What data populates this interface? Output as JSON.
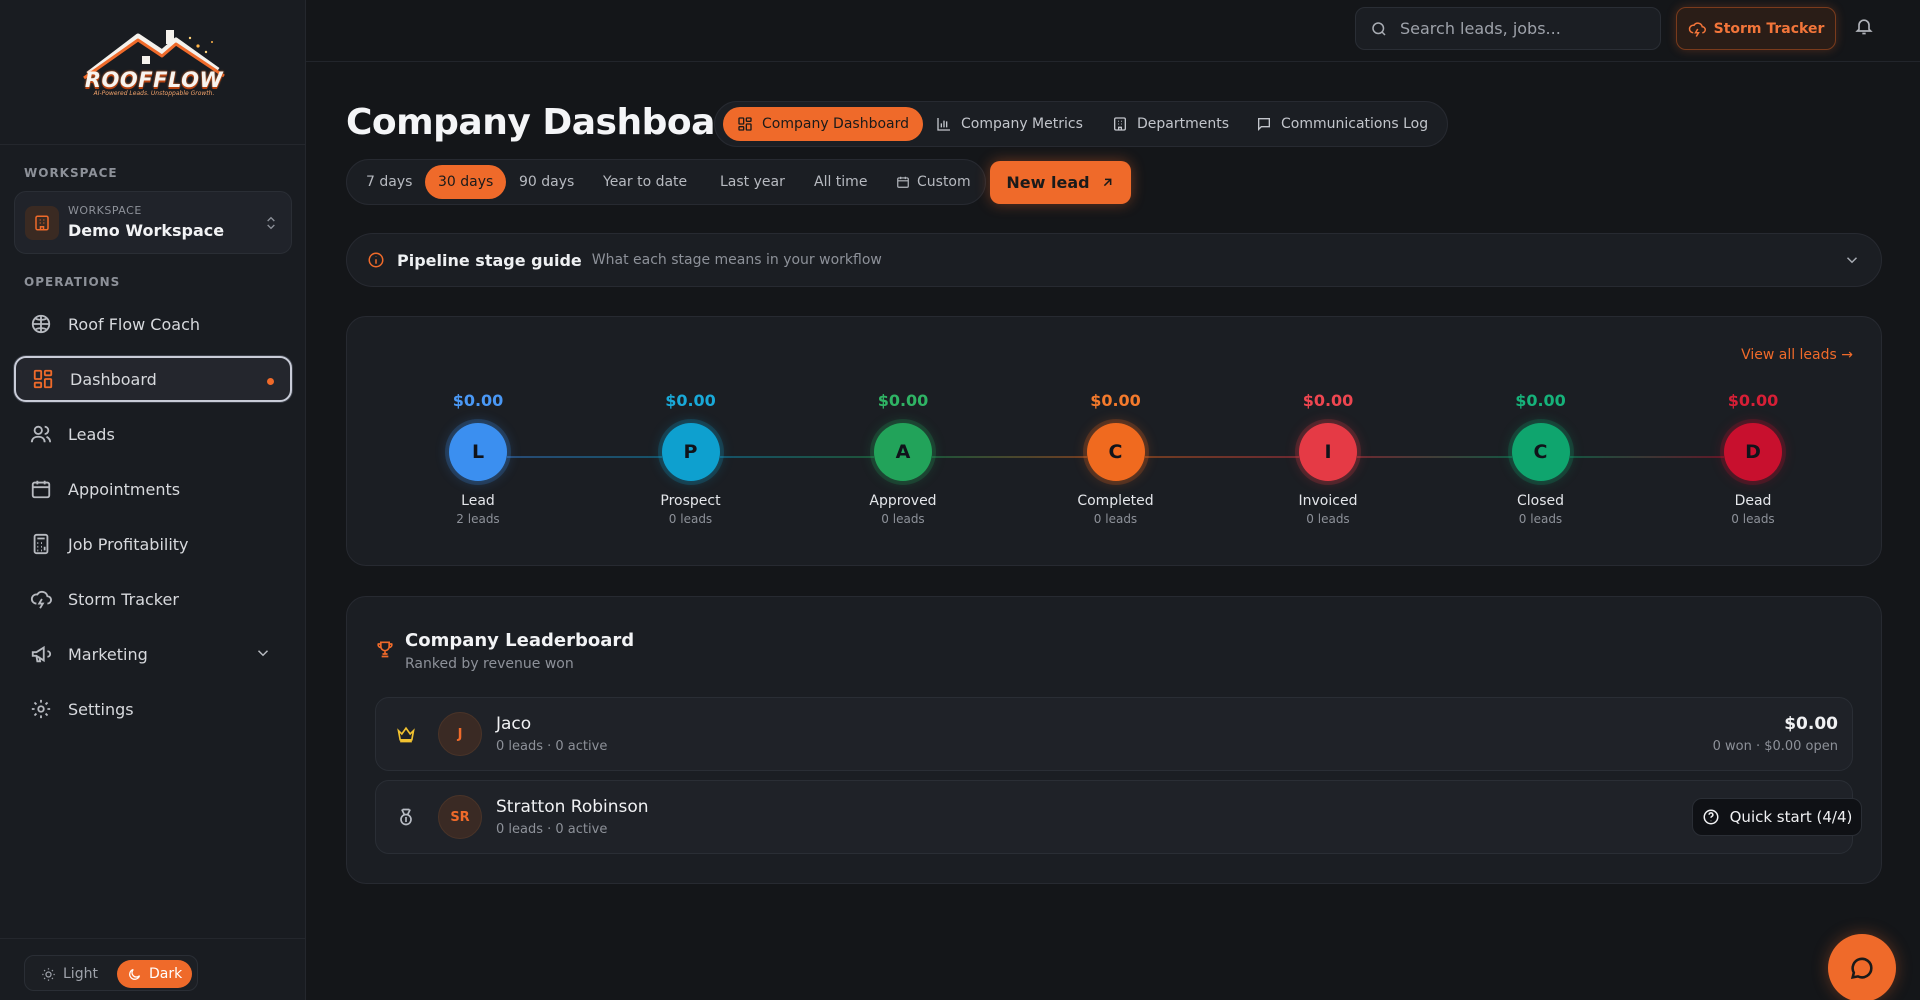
{
  "brand": {
    "name": "ROOFFLOW",
    "tagline": "AI-Powered Leads. Unstoppable Growth."
  },
  "sidebar": {
    "workspace_section": "WORKSPACE",
    "workspace_caption": "WORKSPACE",
    "workspace_name": "Demo Workspace",
    "operations_section": "OPERATIONS",
    "items": [
      {
        "label": "Roof Flow Coach",
        "icon": "coach-icon"
      },
      {
        "label": "Dashboard",
        "icon": "dashboard-icon",
        "active": true
      },
      {
        "label": "Leads",
        "icon": "users-icon"
      },
      {
        "label": "Appointments",
        "icon": "calendar-icon"
      },
      {
        "label": "Job Profitability",
        "icon": "calculator-icon"
      },
      {
        "label": "Storm Tracker",
        "icon": "cloud-lightning-icon"
      },
      {
        "label": "Marketing",
        "icon": "megaphone-icon",
        "expandable": true
      },
      {
        "label": "Settings",
        "icon": "gear-icon"
      }
    ],
    "theme": {
      "light": "Light",
      "dark": "Dark",
      "selected": "Dark"
    }
  },
  "topbar": {
    "search_placeholder": "Search leads, jobs...",
    "storm_button": "Storm Tracker"
  },
  "page": {
    "title": "Company Dashboard",
    "view_tabs": [
      "Company Dashboard",
      "Company Metrics",
      "Departments",
      "Communications Log"
    ],
    "active_view": "Company Dashboard",
    "ranges": [
      "7 days",
      "30 days",
      "90 days",
      "Year to date",
      "Last year",
      "All time",
      "Custom"
    ],
    "active_range": "30 days",
    "new_lead": "New lead"
  },
  "guide": {
    "title": "Pipeline stage guide",
    "subtitle": "What each stage means in your workflow"
  },
  "pipeline": {
    "view_all": "View all leads →",
    "stages": [
      {
        "letter": "L",
        "name": "Lead",
        "amount": "$0.00",
        "count": "2 leads",
        "color": "#3b8ff0",
        "amount_color": "#4a98f5"
      },
      {
        "letter": "P",
        "name": "Prospect",
        "amount": "$0.00",
        "count": "0 leads",
        "color": "#0ea0cf",
        "amount_color": "#19a9d8"
      },
      {
        "letter": "A",
        "name": "Approved",
        "amount": "$0.00",
        "count": "0 leads",
        "color": "#22a35a",
        "amount_color": "#2fb364"
      },
      {
        "letter": "C",
        "name": "Completed",
        "amount": "$0.00",
        "count": "0 leads",
        "color": "#f06a1f",
        "amount_color": "#f47a2c"
      },
      {
        "letter": "I",
        "name": "Invoiced",
        "amount": "$0.00",
        "count": "0 leads",
        "color": "#e53a45",
        "amount_color": "#ee4650"
      },
      {
        "letter": "C",
        "name": "Closed",
        "amount": "$0.00",
        "count": "0 leads",
        "color": "#0fa56e",
        "amount_color": "#16b27a"
      },
      {
        "letter": "D",
        "name": "Dead",
        "amount": "$0.00",
        "count": "0 leads",
        "color": "#c8102e",
        "amount_color": "#d61f36"
      }
    ]
  },
  "leaderboard": {
    "title": "Company Leaderboard",
    "subtitle": "Ranked by revenue won",
    "rows": [
      {
        "initials": "J",
        "name": "Jaco",
        "stats": "0 leads · 0 active",
        "amount": "$0.00",
        "sub": "0 won · $0.00 open",
        "rank_icon": "crown-icon"
      },
      {
        "initials": "SR",
        "name": "Stratton Robinson",
        "stats": "0 leads · 0 active",
        "amount": "",
        "sub": "",
        "rank_icon": "medal-icon"
      }
    ]
  },
  "quick_start": "Quick start (4/4)",
  "colors": {
    "accent": "#ef6a2a",
    "background": "#141619",
    "panel": "#1b1e23"
  }
}
